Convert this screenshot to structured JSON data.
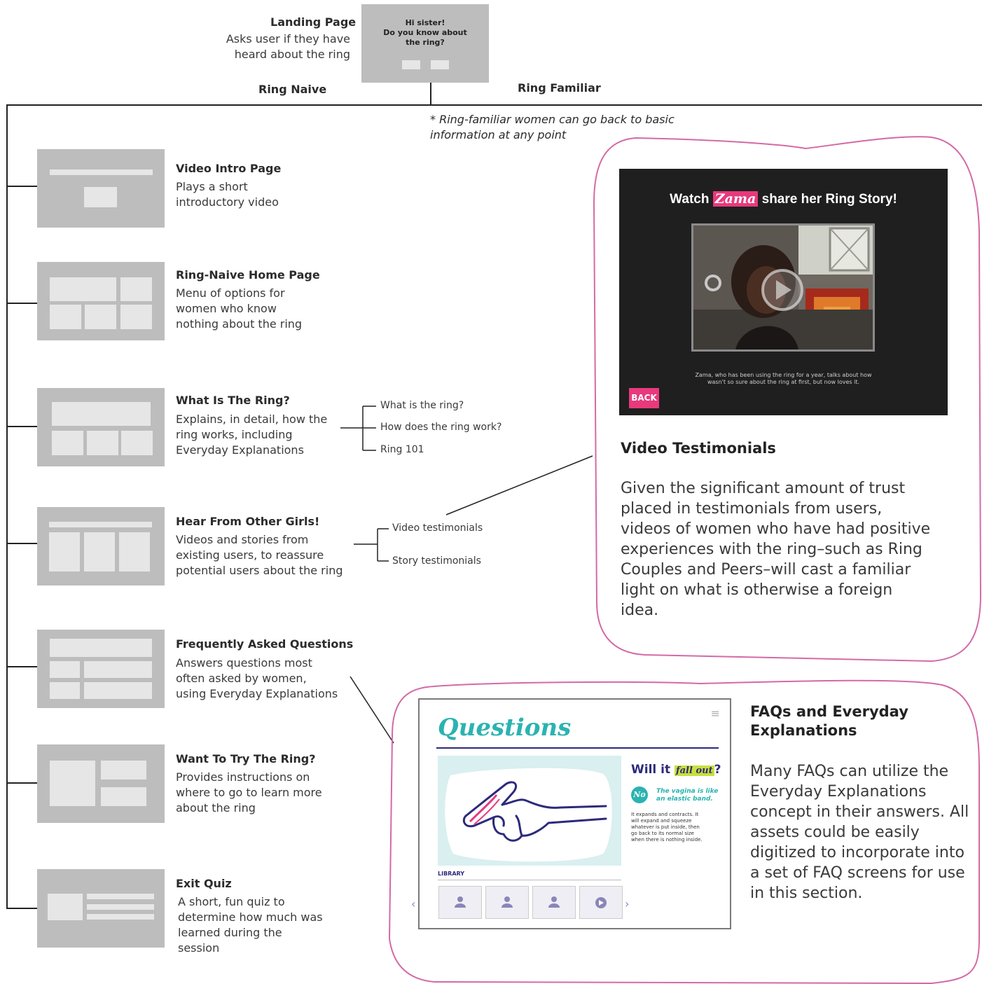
{
  "landing": {
    "title": "Landing Page",
    "desc_line1": "Asks user if they have",
    "desc_line2": "heard about the ring",
    "thumb_line1": "Hi sister!",
    "thumb_line2": "Do you know about",
    "thumb_line3": "the ring?"
  },
  "branches": {
    "naive": "Ring Naive",
    "familiar": "Ring Familiar"
  },
  "note": {
    "line1": "* Ring-familiar women can go back to basic",
    "line2": "information at any point"
  },
  "pages": [
    {
      "title": "Video Intro Page",
      "desc": [
        "Plays a short",
        "introductory video"
      ]
    },
    {
      "title": "Ring-Naive Home Page",
      "desc": [
        "Menu of options for",
        "women who know",
        "nothing about the ring"
      ]
    },
    {
      "title": "What Is The Ring?",
      "desc": [
        "Explains, in detail, how the",
        "ring works, including",
        "Everyday Explanations"
      ]
    },
    {
      "title": "Hear From Other Girls!",
      "desc": [
        "Videos and stories from",
        "existing users, to reassure",
        "potential users about the ring"
      ]
    },
    {
      "title": "Frequently Asked Questions",
      "desc": [
        "Answers questions most",
        "often asked by women,",
        "using Everyday Explanations"
      ]
    },
    {
      "title": "Want To Try The Ring?",
      "desc": [
        "Provides instructions on",
        "where to go to learn more",
        "about the ring"
      ]
    },
    {
      "title": "Exit Quiz",
      "desc": [
        "A short, fun quiz to",
        "determine how much was",
        "learned during the",
        "session"
      ]
    }
  ],
  "ring_subpages": [
    "What is the ring?",
    "How does the ring work?",
    "Ring 101"
  ],
  "testimonial_subpages": [
    "Video testimonials",
    "Story testimonials"
  ],
  "video_card": {
    "screen_title_a": "Watch",
    "screen_title_name": "Zama",
    "screen_title_b": "share her Ring Story!",
    "caption_line1": "Zama, who has been using the ring for a year, talks about how",
    "caption_line2": "wasn't so sure about the ring at first, but now loves it.",
    "back_label": "BACK",
    "title": "Video Testimonials",
    "body": [
      "Given the significant amount of trust",
      "placed in testimonials from users,",
      "videos of women who have had positive",
      "experiences with the ring–such as Ring",
      "Couples and Peers–will cast a familiar",
      "light on what is otherwise a foreign",
      "idea."
    ]
  },
  "faq_card": {
    "screen_heading": "Questions",
    "question_a": "Will it",
    "question_hl": "fall out",
    "question_b": "?",
    "answer_badge": "No",
    "answer_lead_1": "The vagina is like",
    "answer_lead_2": "an elastic band.",
    "answer_detail": [
      "It expands and contracts. It",
      "will expand and squeeze",
      "whatever is put inside, then",
      "go back to its normal size",
      "when there is nothing inside."
    ],
    "library_label": "LIBRARY",
    "title_line1": "FAQs and Everyday",
    "title_line2": "Explanations",
    "body": [
      "Many FAQs can utilize the",
      "Everyday Explanations",
      "concept in their answers. All",
      "assets could be easily",
      "digitized to incorporate into",
      "a set of FAQ screens for use",
      "in this section."
    ]
  },
  "colors": {
    "bubble": "#d46aa6",
    "accent_pink": "#e8397d",
    "teal": "#2bb3b1",
    "navy": "#2d2a7c",
    "lime": "#c8e03c",
    "wire": "#bdbdbd"
  }
}
